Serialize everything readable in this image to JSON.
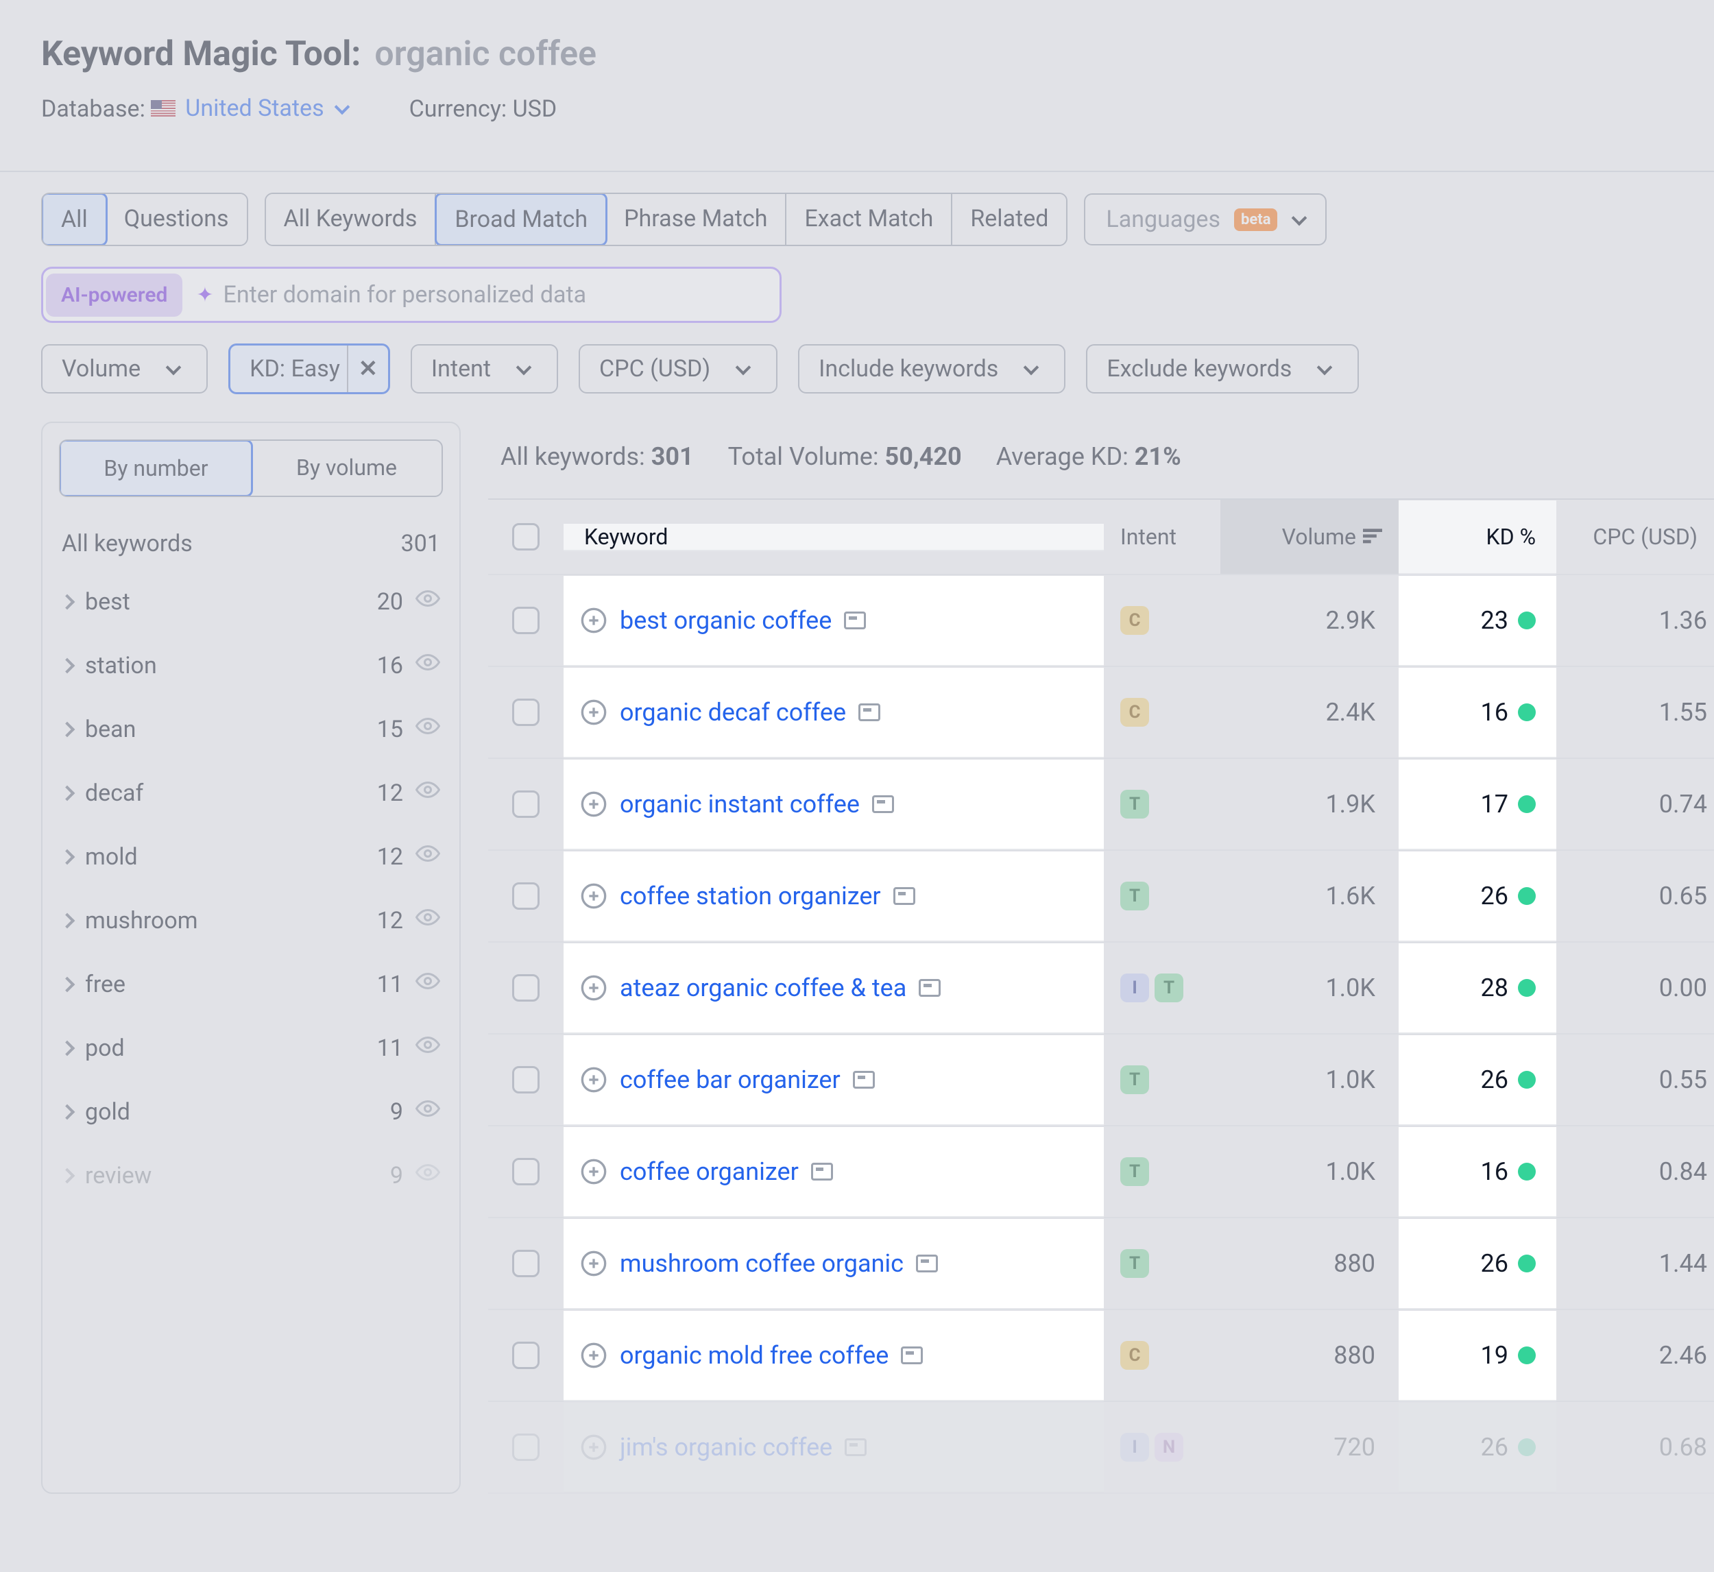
{
  "header": {
    "title": "Keyword Magic Tool:",
    "query": "organic coffee",
    "database_label": "Database:",
    "database_value": "United States",
    "currency_label": "Currency:",
    "currency_value": "USD"
  },
  "toolbar": {
    "questions_seg": {
      "all": "All",
      "questions": "Questions"
    },
    "match_seg": {
      "all_keywords": "All Keywords",
      "broad": "Broad Match",
      "phrase": "Phrase Match",
      "exact": "Exact Match",
      "related": "Related"
    },
    "languages": "Languages",
    "beta": "beta"
  },
  "ai_input": {
    "badge": "AI-powered",
    "placeholder": "Enter domain for personalized data"
  },
  "filters": {
    "volume": "Volume",
    "kd": "KD: Easy",
    "intent": "Intent",
    "cpc": "CPC (USD)",
    "include": "Include keywords",
    "exclude": "Exclude keywords"
  },
  "sidebar": {
    "tabs": {
      "number": "By number",
      "volume": "By volume"
    },
    "summary_label": "All keywords",
    "summary_count": "301",
    "groups": [
      {
        "name": "best",
        "count": "20"
      },
      {
        "name": "station",
        "count": "16"
      },
      {
        "name": "bean",
        "count": "15"
      },
      {
        "name": "decaf",
        "count": "12"
      },
      {
        "name": "mold",
        "count": "12"
      },
      {
        "name": "mushroom",
        "count": "12"
      },
      {
        "name": "free",
        "count": "11"
      },
      {
        "name": "pod",
        "count": "11"
      },
      {
        "name": "gold",
        "count": "9"
      },
      {
        "name": "review",
        "count": "9"
      }
    ]
  },
  "stats": {
    "all_keywords_label": "All keywords:",
    "all_keywords_value": "301",
    "total_volume_label": "Total Volume:",
    "total_volume_value": "50,420",
    "avg_kd_label": "Average KD:",
    "avg_kd_value": "21%"
  },
  "columns": {
    "keyword": "Keyword",
    "intent": "Intent",
    "volume": "Volume",
    "kd": "KD %",
    "cpc": "CPC (USD)"
  },
  "rows": [
    {
      "keyword": "best organic coffee",
      "intents": [
        "C"
      ],
      "volume": "2.9K",
      "kd": "23",
      "cpc": "1.36"
    },
    {
      "keyword": "organic decaf coffee",
      "intents": [
        "C"
      ],
      "volume": "2.4K",
      "kd": "16",
      "cpc": "1.55"
    },
    {
      "keyword": "organic instant coffee",
      "intents": [
        "T"
      ],
      "volume": "1.9K",
      "kd": "17",
      "cpc": "0.74"
    },
    {
      "keyword": "coffee station organizer",
      "intents": [
        "T"
      ],
      "volume": "1.6K",
      "kd": "26",
      "cpc": "0.65"
    },
    {
      "keyword": "ateaz organic coffee & tea",
      "intents": [
        "I",
        "T"
      ],
      "volume": "1.0K",
      "kd": "28",
      "cpc": "0.00"
    },
    {
      "keyword": "coffee bar organizer",
      "intents": [
        "T"
      ],
      "volume": "1.0K",
      "kd": "26",
      "cpc": "0.55"
    },
    {
      "keyword": "coffee organizer",
      "intents": [
        "T"
      ],
      "volume": "1.0K",
      "kd": "16",
      "cpc": "0.84"
    },
    {
      "keyword": "mushroom coffee organic",
      "intents": [
        "T"
      ],
      "volume": "880",
      "kd": "26",
      "cpc": "1.44"
    },
    {
      "keyword": "organic mold free coffee",
      "intents": [
        "C"
      ],
      "volume": "880",
      "kd": "19",
      "cpc": "2.46"
    },
    {
      "keyword": "jim's organic coffee",
      "intents": [
        "I",
        "N"
      ],
      "volume": "720",
      "kd": "26",
      "cpc": "0.68"
    }
  ]
}
